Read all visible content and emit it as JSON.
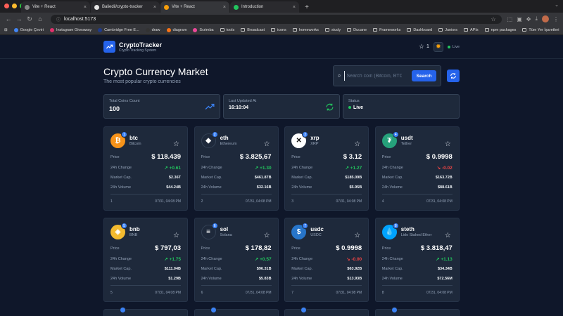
{
  "browser": {
    "tabs": [
      {
        "title": "Vite + React",
        "icon_color": "#888888"
      },
      {
        "title": "Baliedil/crypto-tracker",
        "icon_color": "#e5e5e5"
      },
      {
        "title": "Vite + React",
        "icon_color": "#f59e0b"
      },
      {
        "title": "Introduction",
        "icon_color": "#22c55e"
      }
    ],
    "url": "localhost:5173",
    "bookmarks": [
      "Google Çeviri",
      "Instagram Giveaway",
      "Cambridge Free E...",
      "draw",
      "diagram",
      "Scrimba",
      "tools",
      "Broadcast",
      "icons",
      "homeworks",
      "study",
      "Ducane",
      "Frameworks",
      "Dashboard",
      "Juniors",
      "APIs",
      "npm packages"
    ],
    "bookmarks_right": "Tüm Yer İşaretleri"
  },
  "app": {
    "brand_name": "CryptoTracker",
    "brand_sub": "Crypto Tracking System",
    "fav_count": "1",
    "live_label": "Live",
    "title": "Crypto Currency Market",
    "subtitle": "The most popular crypto currencies",
    "search_placeholder": "Search coin (Bitcoin, BTC...)",
    "search_button": "Search",
    "stats": {
      "total_label": "Total Coins Count",
      "total_value": "100",
      "updated_label": "Last Updated At",
      "updated_value": "16:10:04",
      "status_label": "Status",
      "status_value": "Live"
    },
    "row_labels": {
      "price": "Price",
      "change": "24h Change",
      "cap": "Market Cap.",
      "volume": "24h Volume"
    }
  },
  "coins": [
    {
      "rank": "1",
      "symbol": "btc",
      "name": "Bitcoin",
      "price": "$ 118.439",
      "change": "+0.61",
      "dir": "up",
      "cap": "$2.36T",
      "volume": "$44.24B",
      "time": "07/31, 04:08 PM",
      "color": "#f7931a",
      "glyph": "₿"
    },
    {
      "rank": "2",
      "symbol": "eth",
      "name": "Ethereum",
      "price": "$ 3.825,67",
      "change": "+1.30",
      "dir": "up",
      "cap": "$461.87B",
      "volume": "$32.16B",
      "time": "07/31, 04:08 PM",
      "color": "#1e293b",
      "glyph": "◆"
    },
    {
      "rank": "3",
      "symbol": "xrp",
      "name": "XRP",
      "price": "$ 3.12",
      "change": "+1.27",
      "dir": "up",
      "cap": "$185.09B",
      "volume": "$5.95B",
      "time": "07/31, 04:08 PM",
      "color": "#ffffff",
      "glyph": "✕"
    },
    {
      "rank": "4",
      "symbol": "usdt",
      "name": "Tether",
      "price": "$ 0.9998",
      "change": "-0.02",
      "dir": "down",
      "cap": "$163.72B",
      "volume": "$88.61B",
      "time": "07/31, 04:08 PM",
      "color": "#26a17b",
      "glyph": "₮"
    },
    {
      "rank": "5",
      "symbol": "bnb",
      "name": "BNB",
      "price": "$ 797,03",
      "change": "+1.75",
      "dir": "up",
      "cap": "$111.04B",
      "volume": "$1.29B",
      "time": "07/31, 04:08 PM",
      "color": "#f3ba2f",
      "glyph": "◈"
    },
    {
      "rank": "6",
      "symbol": "sol",
      "name": "Solana",
      "price": "$ 178,82",
      "change": "+0.57",
      "dir": "up",
      "cap": "$96.31B",
      "volume": "$5.83B",
      "time": "07/31, 04:08 PM",
      "color": "#1e293b",
      "glyph": "≡"
    },
    {
      "rank": "7",
      "symbol": "usdc",
      "name": "USDC",
      "price": "$ 0.9998",
      "change": "-0.00",
      "dir": "down",
      "cap": "$63.92B",
      "volume": "$13.93B",
      "time": "07/31, 04:08 PM",
      "color": "#2775ca",
      "glyph": "$"
    },
    {
      "rank": "8",
      "symbol": "steth",
      "name": "Lido Staked Ether",
      "price": "$ 3.818,47",
      "change": "+1.13",
      "dir": "up",
      "cap": "$34.34B",
      "volume": "$72.56M",
      "time": "07/31, 04:08 PM",
      "color": "#00a3ff",
      "glyph": "💧"
    }
  ]
}
